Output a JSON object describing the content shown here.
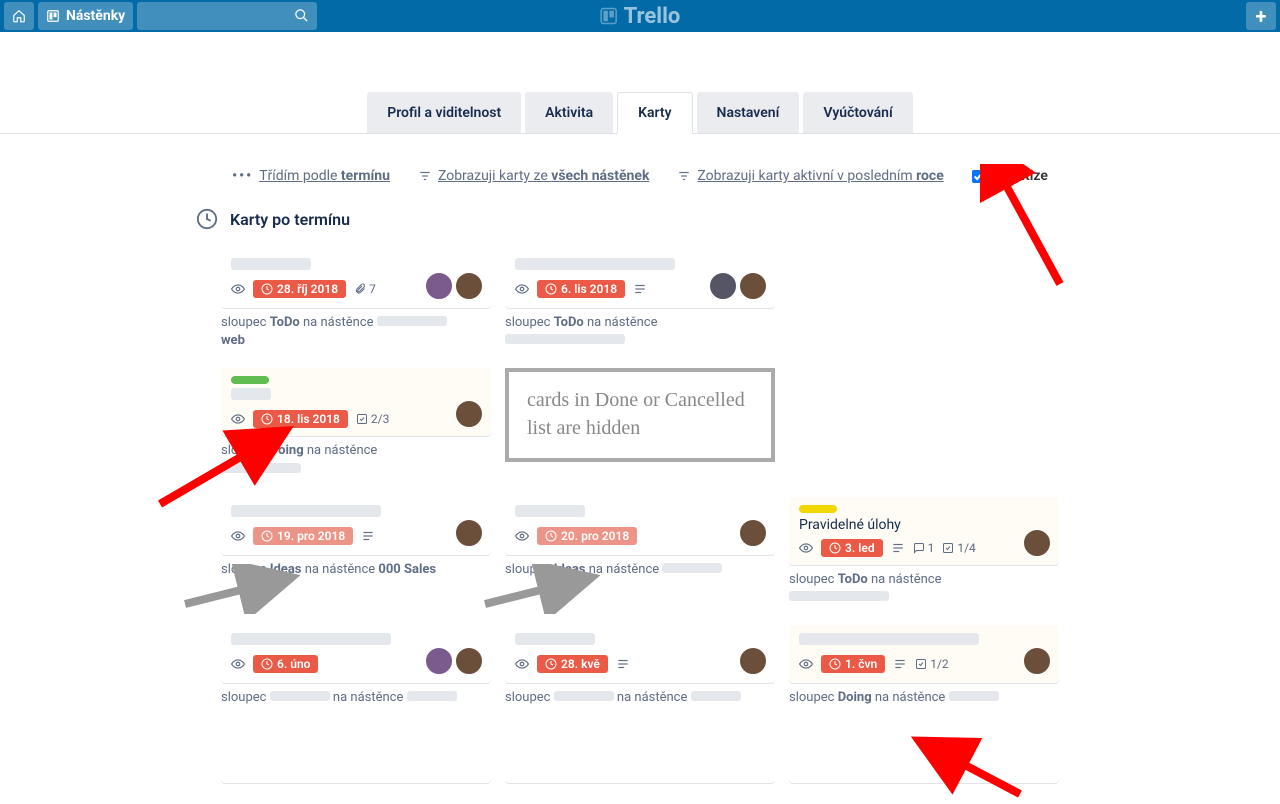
{
  "header": {
    "boards": "Nástěnky",
    "logo": "Trello"
  },
  "tabs": {
    "t1": "Profil a viditelnost",
    "t2": "Aktivita",
    "t3": "Karty",
    "t4": "Nastavení",
    "t5": "Vyúčtování"
  },
  "filters": {
    "sort_pre": "Třídím podle ",
    "sort_b": "termínu",
    "f1_pre": "Zobrazuji karty ze ",
    "f1_b": "všech nástěnek",
    "f2_pre": "Zobrazuji karty aktivní v posledním ",
    "f2_b": "roce",
    "prio": "Prioritize"
  },
  "section": {
    "heading": "Karty po termínu"
  },
  "annot": "cards in Done or Cancelled list are hidden",
  "cards": [
    {
      "date": "28. říj 2018",
      "attach": "7",
      "meta_pre": "sloupec ",
      "meta_b": "ToDo",
      "meta_post": " na nástěnce",
      "meta_post2": "web"
    },
    {
      "date": "6. lis 2018",
      "meta_pre": "sloupec ",
      "meta_b": "ToDo",
      "meta_post": " na nástěnce"
    },
    {
      "date": "18. lis 2018",
      "check": "2/3",
      "meta_pre": "sloupec ",
      "meta_b": "Doing",
      "meta_post": " na nástěnce"
    },
    {
      "date": "19. pro 2018",
      "meta_pre": "sloupec ",
      "meta_b": "Ideas",
      "meta_post": " na nástěnce ",
      "meta_b2": "000 Sales"
    },
    {
      "date": "20. pro 2018",
      "meta_pre": "sloupec ",
      "meta_b": "Ideas",
      "meta_post": " na nástěnce"
    },
    {
      "title": "Pravidelné úlohy",
      "date": "3. led",
      "comments": "1",
      "check": "1/4",
      "meta_pre": "sloupec ",
      "meta_b": "ToDo",
      "meta_post": " na nástěnce"
    },
    {
      "date": "6. úno",
      "meta_pre": "sloupec ",
      "meta_post": " na nástěnce"
    },
    {
      "date": "28. kvě",
      "meta_pre": "sloupec ",
      "meta_post": " na nástěnce"
    },
    {
      "date": "1. čvn",
      "check": "1/2",
      "meta_pre": "sloupec ",
      "meta_b": "Doing",
      "meta_post": " na nástěnce"
    }
  ]
}
